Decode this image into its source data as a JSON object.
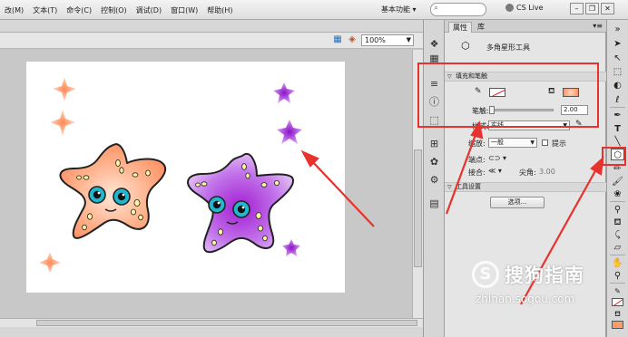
{
  "menu": [
    "改(M)",
    "文本(T)",
    "命令(C)",
    "控制(O)",
    "调试(D)",
    "窗口(W)",
    "帮助(H)"
  ],
  "workspace_label": "基本功能 ▾",
  "cs_live": "CS Live",
  "zoom": "100%",
  "panel": {
    "tab_properties": "属性",
    "tab_library": "库",
    "tool_name": "多角星形工具",
    "section_fill_stroke": "填充和笔触",
    "stroke_label": "笔触:",
    "stroke_value": "2.00",
    "style_label": "样式:",
    "style_value": "实线",
    "scale_label": "缩放:",
    "scale_value": "一般",
    "hint_label": "提示",
    "cap_label": "端点:",
    "join_label": "接合:",
    "miter_label": "尖角:",
    "miter_value": "3.00",
    "section_tool_settings": "工具设置",
    "options_button": "选项..."
  },
  "watermark": {
    "logo": "S",
    "title": "搜狗指南",
    "url": "zhinan.sogou.com"
  },
  "colors": {
    "fill": "#ffa279",
    "stroke": "none",
    "annotation": "#e8322d",
    "purple_star": "#a63fd6",
    "orange_star": "#ffa070"
  }
}
